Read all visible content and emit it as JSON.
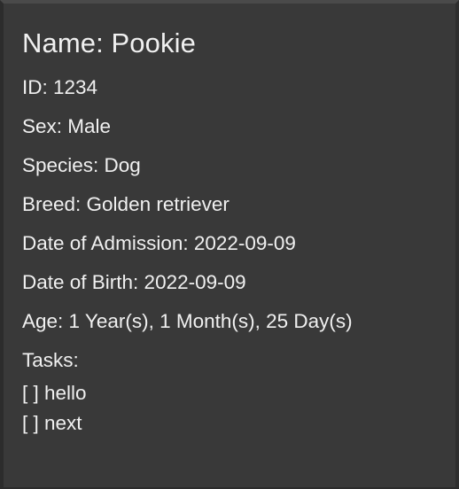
{
  "pet": {
    "name_line": "Name: Pookie",
    "id_line": "ID: 1234",
    "sex_line": "Sex: Male",
    "species_line": "Species: Dog",
    "breed_line": "Breed: Golden retriever",
    "admission_line": "Date of Admission: 2022-09-09",
    "birth_line": "Date of Birth: 2022-09-09",
    "age_line": "Age: 1 Year(s), 1 Month(s), 25 Day(s)",
    "tasks_heading": "Tasks:",
    "tasks": [
      "[ ] hello",
      "[ ] next"
    ]
  },
  "colors": {
    "background": "#393939",
    "text": "#f0f0f0"
  }
}
